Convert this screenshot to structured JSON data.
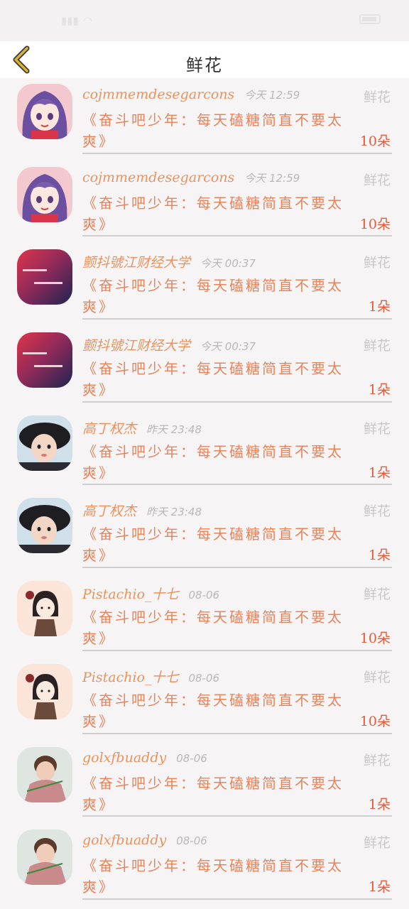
{
  "header": {
    "title": "鲜花"
  },
  "colors": {
    "name": "#e8935f",
    "message": "#e8835a",
    "count": "#e85a3a",
    "back_arrow": "#c9a32a"
  },
  "items": [
    {
      "avatar": "anime-girl-avatar",
      "name": "cojmmemdesegarcons",
      "time": "今天 12:59",
      "gift": "鲜花",
      "message": "《奋斗吧少年：每天磕糖简直不要太爽》",
      "count": "10朵"
    },
    {
      "avatar": "anime-girl-avatar",
      "name": "cojmmemdesegarcons",
      "time": "今天 12:59",
      "gift": "鲜花",
      "message": "《奋斗吧少年：每天磕糖简直不要太爽》",
      "count": "10朵"
    },
    {
      "avatar": "gradient-text-avatar",
      "name": "颤抖號江财经大学",
      "time": "今天 00:37",
      "gift": "鲜花",
      "message": "《奋斗吧少年：每天磕糖简直不要太爽》",
      "count": "1朵"
    },
    {
      "avatar": "gradient-text-avatar",
      "name": "颤抖號江财经大学",
      "time": "今天 00:37",
      "gift": "鲜花",
      "message": "《奋斗吧少年：每天磕糖简直不要太爽》",
      "count": "1朵"
    },
    {
      "avatar": "child-photo-avatar",
      "name": "高丁权杰",
      "time": "昨天 23:48",
      "gift": "鲜花",
      "message": "《奋斗吧少年：每天磕糖简直不要太爽》",
      "count": "1朵"
    },
    {
      "avatar": "child-photo-avatar",
      "name": "高丁权杰",
      "time": "昨天 23:48",
      "gift": "鲜花",
      "message": "《奋斗吧少年：每天磕糖简直不要太爽》",
      "count": "1朵"
    },
    {
      "avatar": "cartoon-girl-avatar",
      "name": "Pistachio_十七",
      "time": "08-06",
      "gift": "鲜花",
      "message": "《奋斗吧少年：每天磕糖简直不要太爽》",
      "count": "10朵"
    },
    {
      "avatar": "cartoon-girl-avatar",
      "name": "Pistachio_十七",
      "time": "08-06",
      "gift": "鲜花",
      "message": "《奋斗吧少年：每天磕糖简直不要太爽》",
      "count": "10朵"
    },
    {
      "avatar": "boy-photo-avatar",
      "name": "golxfbuaddy",
      "time": "08-06",
      "gift": "鲜花",
      "message": "《奋斗吧少年：每天磕糖简直不要太爽》",
      "count": "1朵"
    },
    {
      "avatar": "boy-photo-avatar",
      "name": "golxfbuaddy",
      "time": "08-06",
      "gift": "鲜花",
      "message": "《奋斗吧少年：每天磕糖简直不要太爽》",
      "count": "1朵"
    }
  ]
}
